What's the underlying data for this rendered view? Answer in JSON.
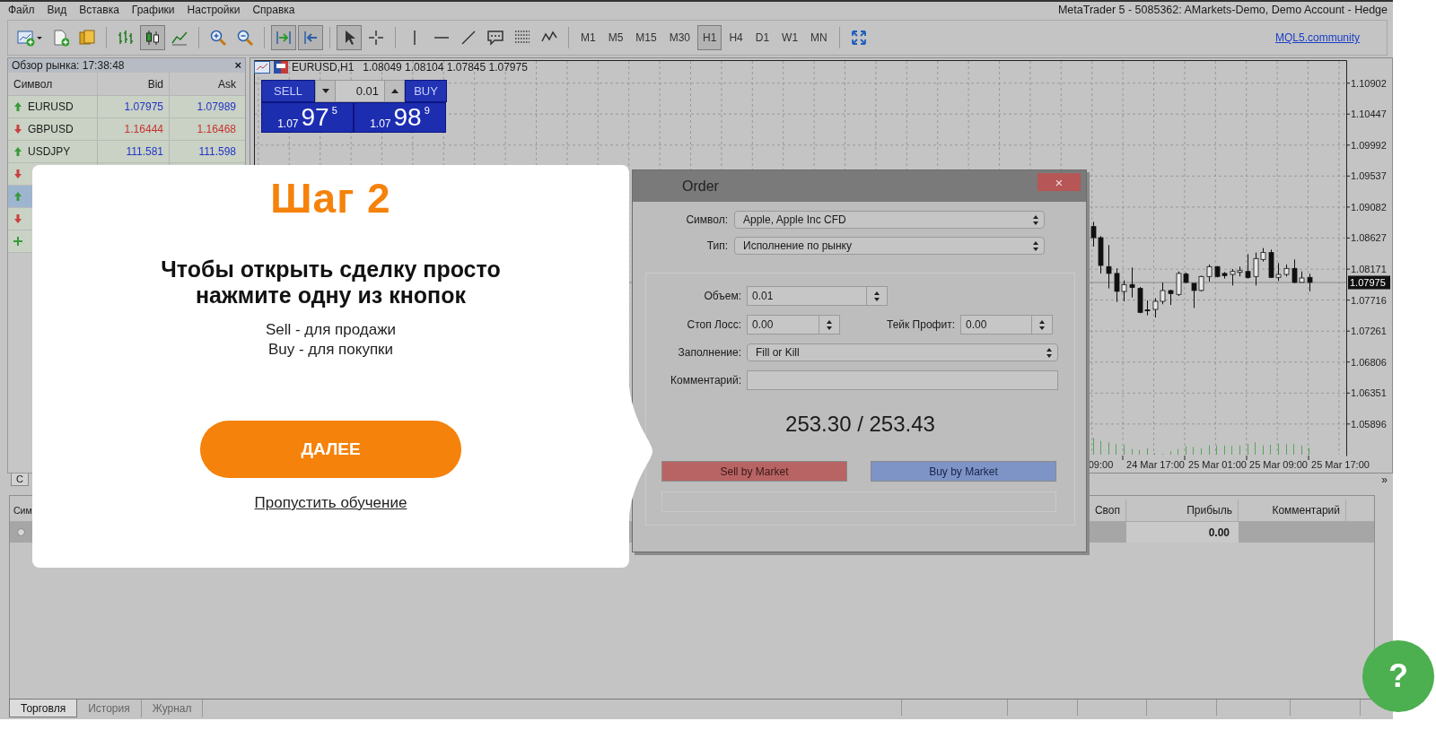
{
  "menu": [
    "Файл",
    "Вид",
    "Вставка",
    "Графики",
    "Настройки",
    "Справка"
  ],
  "window_title": "MetaTrader 5 - 5085362: AMarkets-Demo, Demo Account - Hedge",
  "toolbar": {
    "groups": [
      {
        "items": [
          {
            "kind": "new-chart",
            "pressed": false
          },
          {
            "kind": "new-doc",
            "pressed": false
          },
          {
            "kind": "profiles",
            "pressed": false
          }
        ]
      },
      {
        "items": [
          {
            "kind": "bars",
            "pressed": false
          },
          {
            "kind": "candles",
            "pressed": true
          },
          {
            "kind": "line",
            "pressed": false
          }
        ]
      },
      {
        "items": [
          {
            "kind": "zoom-in",
            "pressed": false
          },
          {
            "kind": "zoom-out",
            "pressed": false
          }
        ]
      },
      {
        "items": [
          {
            "kind": "autoscroll",
            "pressed": true
          },
          {
            "kind": "shift",
            "pressed": true
          }
        ]
      },
      {
        "items": [
          {
            "kind": "cursor",
            "pressed": true
          },
          {
            "kind": "crosshair",
            "pressed": false
          }
        ]
      },
      {
        "items": [
          {
            "kind": "vline",
            "pressed": false
          },
          {
            "kind": "hline",
            "pressed": false
          },
          {
            "kind": "trend",
            "pressed": false
          },
          {
            "kind": "comment",
            "pressed": false
          },
          {
            "kind": "fibo",
            "pressed": false
          },
          {
            "kind": "elliott",
            "pressed": false
          }
        ]
      },
      {
        "items": [
          {
            "kind": "timeframe",
            "label": "M1",
            "selected": false
          },
          {
            "kind": "timeframe",
            "label": "M5",
            "selected": false
          },
          {
            "kind": "timeframe",
            "label": "M15",
            "selected": false
          },
          {
            "kind": "timeframe",
            "label": "M30",
            "selected": false
          },
          {
            "kind": "timeframe",
            "label": "H1",
            "selected": true
          },
          {
            "kind": "timeframe",
            "label": "H4",
            "selected": false
          },
          {
            "kind": "timeframe",
            "label": "D1",
            "selected": false
          },
          {
            "kind": "timeframe",
            "label": "W1",
            "selected": false
          },
          {
            "kind": "timeframe",
            "label": "MN",
            "selected": false
          }
        ]
      },
      {
        "items": [
          {
            "kind": "fullscreen",
            "pressed": false
          }
        ]
      }
    ],
    "community_link": "MQL5.community"
  },
  "market_watch": {
    "title": "Обзор рынка: 17:38:48",
    "close": "×",
    "columns": [
      "Символ",
      "Bid",
      "Ask"
    ],
    "rows": [
      {
        "symbol": "EURUSD",
        "bid": "1.07975",
        "ask": "1.07989",
        "kind": "up",
        "selected": false
      },
      {
        "symbol": "GBPUSD",
        "bid": "1.16444",
        "ask": "1.16468",
        "kind": "down",
        "selected": false
      },
      {
        "symbol": "USDJPY",
        "bid": "111.581",
        "ask": "111.598",
        "kind": "up",
        "selected": false
      },
      {
        "kind": "down",
        "selected": false
      },
      {
        "kind": "up",
        "selected": true
      },
      {
        "kind": "down",
        "selected": false
      },
      {
        "kind": "add",
        "selected": false
      }
    ],
    "tab": "С"
  },
  "chart": {
    "symbol": "EURUSD,H1",
    "ohlc": "1.08049 1.08104 1.07845 1.07975",
    "one_click": {
      "sell": {
        "label": "SELL",
        "price_small": "1.07",
        "price_big": "97",
        "price_sup": "5"
      },
      "volume": "0.01",
      "buy": {
        "label": "BUY",
        "price_small": "1.07",
        "price_big": "98",
        "price_sup": "9"
      }
    },
    "current_price": "1.07975",
    "chart_data": {
      "type": "candlestick",
      "categories": [
        null,
        null,
        null,
        null,
        null,
        null,
        null,
        null,
        null,
        null,
        null,
        null,
        null,
        null,
        null,
        null,
        null,
        null,
        null,
        null,
        null,
        null,
        null,
        null,
        null,
        null,
        null,
        null,
        null,
        null,
        null,
        null,
        null,
        null,
        null,
        null,
        null,
        null,
        null,
        null,
        null,
        null,
        null,
        null,
        null,
        null,
        null,
        null,
        null,
        null,
        null,
        null,
        null,
        null,
        null,
        null,
        null,
        null,
        null,
        null,
        null,
        null,
        null,
        null,
        null,
        null,
        null,
        null,
        null,
        null,
        null,
        null,
        null,
        null,
        null,
        null,
        null,
        null,
        null,
        null,
        null,
        null,
        null,
        null,
        null,
        null,
        null,
        null,
        null,
        null,
        null,
        null,
        null,
        null,
        null,
        null,
        null,
        null,
        null,
        null,
        null,
        null,
        null,
        null,
        null,
        null,
        null,
        null,
        null,
        "09:00",
        null,
        null,
        null,
        null,
        null,
        null,
        "24 Mar 17:00",
        null,
        null,
        null,
        null,
        null,
        null,
        null,
        "25 Mar 01:00",
        null,
        null,
        null,
        null,
        null,
        null,
        null,
        "25 Mar 09:00",
        null,
        null,
        null,
        null,
        null,
        null,
        null,
        "25 Mar 17:00"
      ],
      "ohlc": [
        null,
        null,
        null,
        null,
        null,
        null,
        null,
        null,
        null,
        null,
        null,
        null,
        null,
        null,
        null,
        null,
        null,
        null,
        null,
        null,
        null,
        null,
        null,
        null,
        null,
        null,
        null,
        null,
        null,
        null,
        null,
        null,
        null,
        null,
        null,
        null,
        null,
        null,
        null,
        null,
        null,
        null,
        null,
        null,
        null,
        null,
        null,
        null,
        null,
        null,
        null,
        null,
        null,
        null,
        null,
        null,
        null,
        null,
        null,
        null,
        null,
        null,
        null,
        null,
        null,
        null,
        null,
        null,
        null,
        null,
        null,
        null,
        null,
        null,
        null,
        null,
        null,
        null,
        null,
        null,
        null,
        null,
        null,
        null,
        null,
        null,
        null,
        null,
        null,
        null,
        null,
        null,
        null,
        null,
        null,
        null,
        null,
        null,
        null,
        null,
        null,
        null,
        null,
        null,
        null,
        null,
        null,
        null,
        [
          1.08796,
          1.08866,
          1.08501,
          1.08633
        ],
        [
          1.08633,
          1.08655,
          1.08107,
          1.08225
        ],
        [
          1.08207,
          1.08523,
          1.07887,
          1.08107
        ],
        [
          1.08107,
          1.08181,
          1.07689,
          1.07843
        ],
        [
          1.07843,
          1.08005,
          1.07698,
          1.07944
        ],
        [
          1.07944,
          1.08194,
          1.07755,
          1.079
        ],
        [
          1.07887,
          1.07909,
          1.07523,
          1.07536
        ],
        [
          1.07571,
          1.07711,
          1.07492,
          1.07558
        ],
        [
          1.0758,
          1.07742,
          1.07461,
          1.07698
        ],
        [
          1.07698,
          1.07975,
          1.07654,
          1.07856
        ],
        [
          1.07856,
          1.07865,
          1.07645,
          1.07812
        ],
        [
          1.07799,
          1.08137,
          1.07777,
          1.08107
        ],
        [
          1.08098,
          1.0812,
          1.07962,
          1.07975
        ],
        [
          1.07962,
          1.07962,
          1.07601,
          1.07856
        ],
        [
          1.07856,
          1.08076,
          1.07843,
          1.08062
        ],
        [
          1.08062,
          1.08238,
          1.07988,
          1.08207
        ],
        [
          1.08207,
          1.08216,
          1.08049,
          1.08062
        ],
        [
          1.08107,
          1.08128,
          1.08032,
          1.08076
        ],
        [
          1.08093,
          1.08172,
          1.07931,
          1.08137
        ],
        [
          1.08124,
          1.08207,
          1.08062,
          1.0815
        ],
        [
          1.08137,
          1.08392,
          1.08032,
          1.08049
        ],
        [
          1.08062,
          1.08414,
          1.07931,
          1.08326
        ],
        [
          1.08313,
          1.0848,
          1.08282,
          1.08414
        ],
        [
          1.08414,
          1.08458,
          1.0804,
          1.08049
        ],
        [
          1.08049,
          1.0826,
          1.07997,
          1.08093
        ],
        [
          1.08093,
          1.08238,
          1.08062,
          1.08181
        ],
        [
          1.08181,
          1.08313,
          1.07962,
          1.07975
        ],
        [
          1.07975,
          1.08137,
          1.07975,
          1.0804
        ],
        [
          1.08049,
          1.08104,
          1.07845,
          1.07975
        ],
        null,
        null,
        null,
        null
      ],
      "yticks": [
        1.10902,
        1.10447,
        1.09992,
        1.09537,
        1.09082,
        1.08627,
        1.08171,
        1.07716,
        1.07261,
        1.06806,
        1.06351,
        1.05896
      ],
      "ylim": [
        1.05433,
        1.1124
      ],
      "grid": true,
      "ref_lines": [
        {
          "axis": "y",
          "value": 1.07975
        }
      ]
    },
    "more": "»"
  },
  "order_dialog": {
    "title": "Order",
    "close": "×",
    "symbol": {
      "label": "Символ:",
      "value": "Apple, Apple Inc CFD"
    },
    "type": {
      "label": "Тип:",
      "value": "Исполнение по рынку"
    },
    "volume": {
      "label": "Объем:",
      "value": "0.01"
    },
    "stop_loss": {
      "label": "Стоп Лосс:",
      "value": "0.00"
    },
    "take_profit": {
      "label": "Тейк Профит:",
      "value": "0.00"
    },
    "filling": {
      "label": "Заполнение:",
      "value": "Fill or Kill"
    },
    "comment": {
      "label": "Комментарий:"
    },
    "prices": "253.30 / 253.43",
    "sell_button": "Sell by Market",
    "buy_button": "Buy by Market"
  },
  "tutorial": {
    "step": "Шаг 2",
    "heading": "Чтобы открыть сделку просто нажмите одну из кнопок",
    "lines": [
      "Sell - для продажи",
      "Buy - для покупки"
    ],
    "next_button": "ДАЛЕЕ",
    "skip_link": "Пропустить обучение"
  },
  "terminal": {
    "columns": [
      "Сим",
      "Своп",
      "Прибыль",
      "Комментарий"
    ],
    "row": {
      "profit": "0.00"
    },
    "tabs": [
      {
        "label": "Торговля",
        "selected": true
      },
      {
        "label": "История",
        "selected": false
      },
      {
        "label": "Журнал",
        "selected": false
      }
    ]
  },
  "help_button": "?"
}
